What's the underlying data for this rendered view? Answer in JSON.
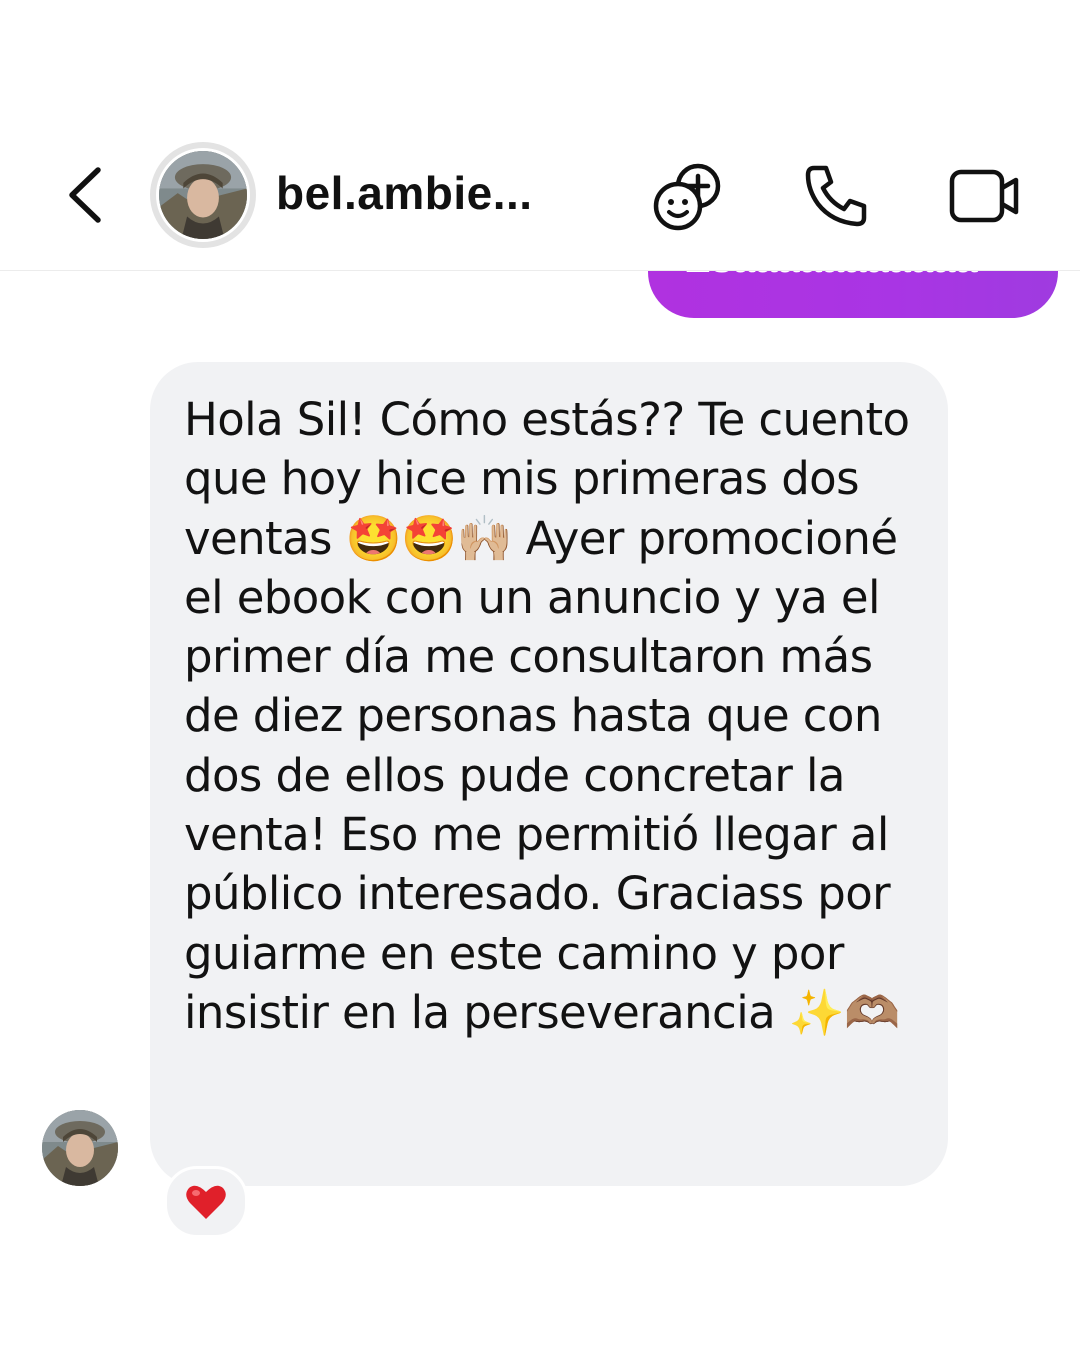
{
  "header": {
    "username": "bel.ambie..."
  },
  "sent_message": {
    "text": "Esaaaaaaaaaaa"
  },
  "received_message": {
    "text": "Hola Sil! Cómo estás?? Te cuento que hoy hice mis primeras dos ventas 🤩🤩🙌🏼 Ayer promocioné el ebook con un anuncio y ya el primer día me consultaron más de diez personas hasta que con dos de ellos pude concretar la venta! Eso me permitió llegar al público interesado. Graciass por guiarme en este camino y por insistir en la perseverancia ✨🫶🏽"
  },
  "reaction": {
    "emoji": "❤️"
  },
  "icons": {
    "back": "chevron-left-icon",
    "effects": "sticker-effects-icon",
    "call": "phone-icon",
    "video": "video-camera-icon",
    "reaction": "heart-icon"
  },
  "colors": {
    "sent_bubble": "#a935e4",
    "received_bubble": "#f1f2f4",
    "reaction_heart": "#e0202a"
  }
}
